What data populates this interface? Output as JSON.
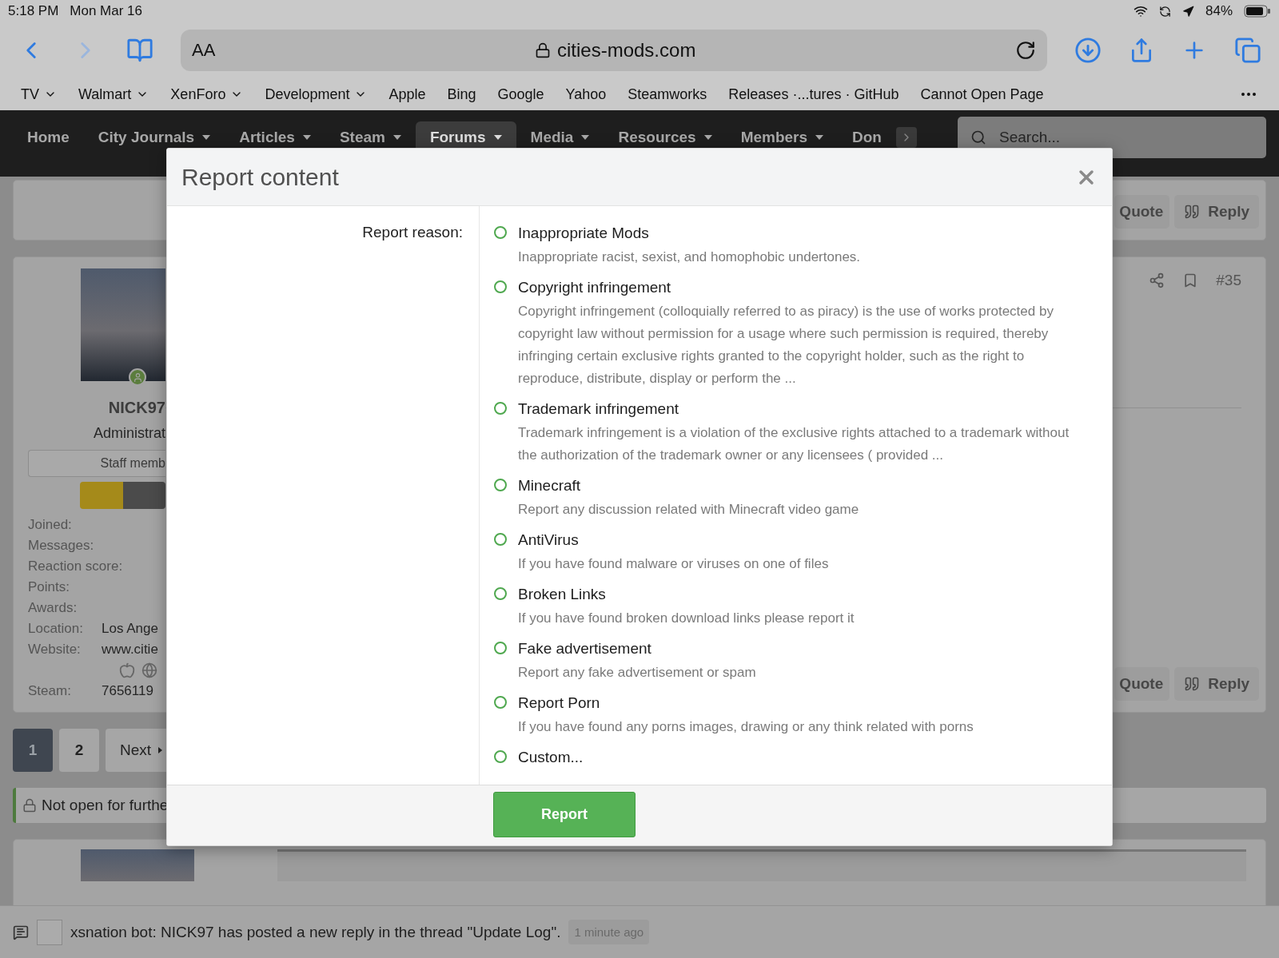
{
  "status_bar": {
    "time": "5:18 PM",
    "date": "Mon Mar 16",
    "battery": "84%"
  },
  "browser": {
    "text_size_button": "AA",
    "address": "cities-mods.com"
  },
  "bookmarks": [
    {
      "label": "TV",
      "has_menu": true
    },
    {
      "label": "Walmart",
      "has_menu": true
    },
    {
      "label": "XenForo",
      "has_menu": true
    },
    {
      "label": "Development",
      "has_menu": true
    },
    {
      "label": "Apple",
      "has_menu": false
    },
    {
      "label": "Bing",
      "has_menu": false
    },
    {
      "label": "Google",
      "has_menu": false
    },
    {
      "label": "Yahoo",
      "has_menu": false
    },
    {
      "label": "Steamworks",
      "has_menu": false
    },
    {
      "label": "Releases ·...tures · GitHub",
      "has_menu": false
    },
    {
      "label": "Cannot Open Page",
      "has_menu": false
    }
  ],
  "site_nav": {
    "items": [
      {
        "label": "Home",
        "has_menu": false,
        "selected": false
      },
      {
        "label": "City Journals",
        "has_menu": true,
        "selected": false
      },
      {
        "label": "Articles",
        "has_menu": true,
        "selected": false
      },
      {
        "label": "Steam",
        "has_menu": true,
        "selected": false
      },
      {
        "label": "Forums",
        "has_menu": true,
        "selected": true
      },
      {
        "label": "Media",
        "has_menu": true,
        "selected": false
      },
      {
        "label": "Resources",
        "has_menu": true,
        "selected": false
      },
      {
        "label": "Members",
        "has_menu": true,
        "selected": false
      },
      {
        "label": "Don",
        "has_menu": false,
        "selected": false
      }
    ],
    "search_placeholder": "Search..."
  },
  "previous_post": {
    "actions": [
      "Quote",
      "Reply"
    ]
  },
  "post": {
    "author": "NICK97",
    "role": "Administrat",
    "banner": "Staff memb",
    "stats": [
      {
        "label": "Joined:"
      },
      {
        "label": "Messages:"
      },
      {
        "label": "Reaction score:"
      },
      {
        "label": "Points:"
      },
      {
        "label": "Awards:"
      },
      {
        "label": "Location:",
        "value": "Los Ange"
      },
      {
        "label": "Website:",
        "value": "www.citie"
      },
      {
        "label": "Steam:",
        "value": "7656119"
      }
    ],
    "number": "#35",
    "actions": [
      "Quote",
      "Reply"
    ]
  },
  "pagination": {
    "pages": [
      {
        "label": "1",
        "selected": true
      },
      {
        "label": "2",
        "selected": false
      }
    ],
    "next": "Next"
  },
  "locked_notice": "Not open for furthe",
  "notification": {
    "text": "xsnation bot: NICK97 has posted a new reply in the thread \"Update Log\".",
    "time": "1 minute ago"
  },
  "dialog": {
    "title": "Report content",
    "field_label": "Report reason:",
    "submit": "Report",
    "options": [
      {
        "label": "Inappropriate Mods",
        "description": "Inappropriate racist, sexist, and homophobic undertones.",
        "selected": false
      },
      {
        "label": "Copyright infringement",
        "description": "Copyright infringement (colloquially referred to as piracy) is the use of works protected by copyright law without permission for a usage where such permission is required, thereby infringing certain exclusive rights granted to the copyright holder, such as the right to reproduce, distribute, display or perform the ...",
        "selected": false
      },
      {
        "label": "Trademark infringement",
        "description": "Trademark infringement is a violation of the exclusive rights attached to a trademark without the authorization of the trademark owner or any licensees ( provided ...",
        "selected": false
      },
      {
        "label": "Minecraft",
        "description": "Report any discussion related with Minecraft video game",
        "selected": false
      },
      {
        "label": "AntiVirus",
        "description": "If you have found malware or viruses on one of files",
        "selected": false
      },
      {
        "label": "Broken Links",
        "description": "If you have found broken download links please report it",
        "selected": false
      },
      {
        "label": "Fake advertisement",
        "description": "Report any fake advertisement or spam",
        "selected": false
      },
      {
        "label": "Report Porn",
        "description": "If you have found any porns images, drawing or any think related with porns",
        "selected": false
      },
      {
        "label": "Custom...",
        "selected": false
      }
    ]
  }
}
